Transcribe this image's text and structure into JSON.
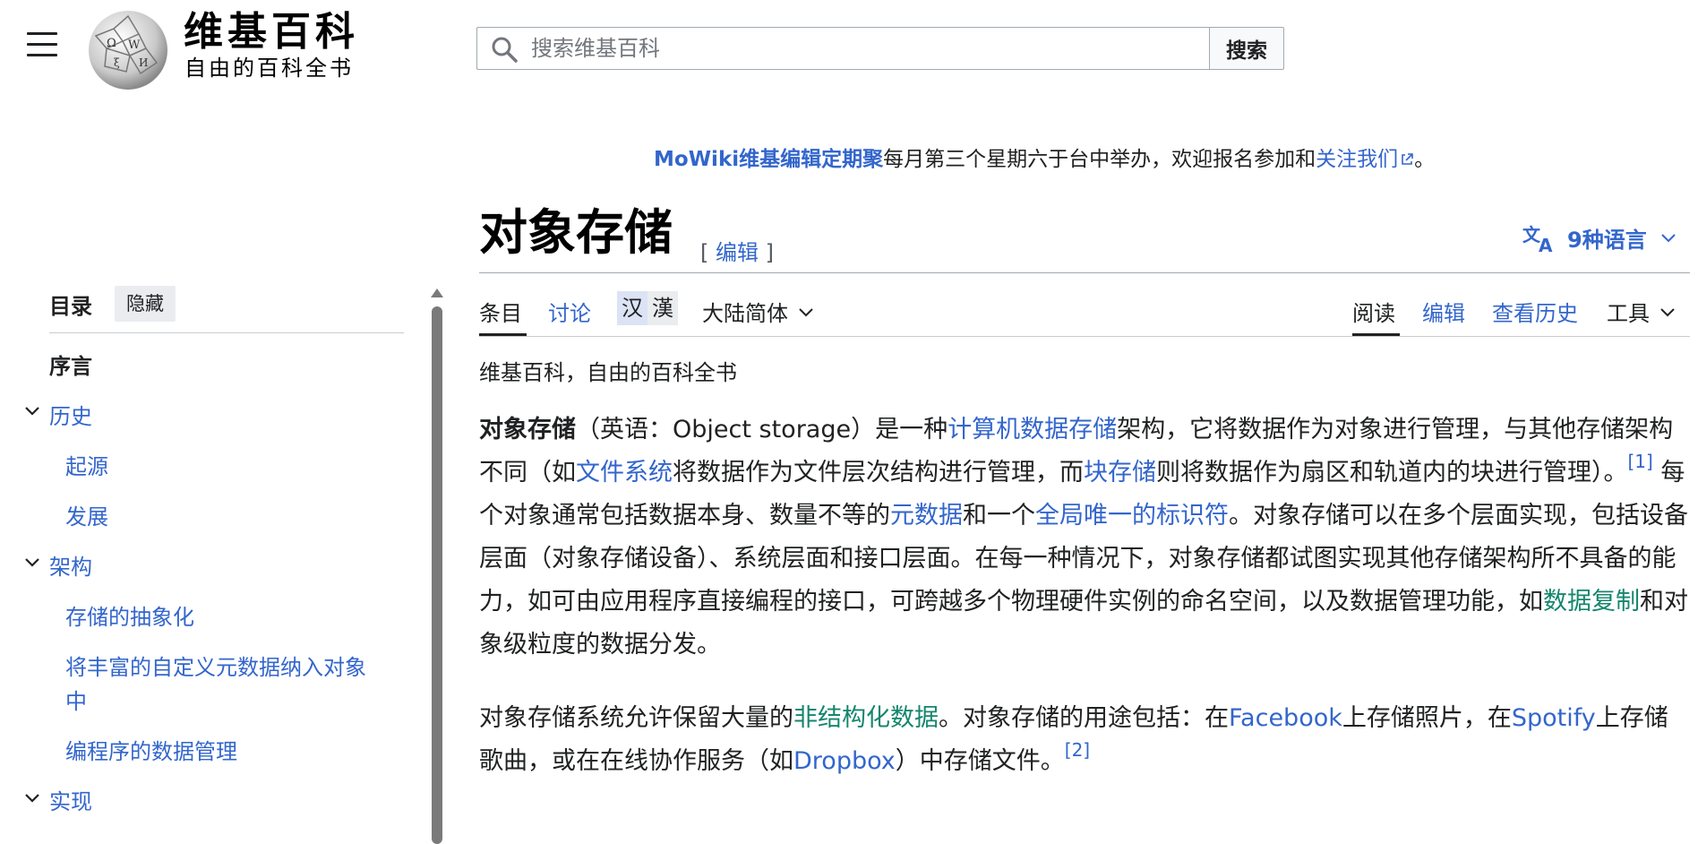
{
  "site": {
    "wordmark": "维基百科",
    "tagline": "自由的百科全书"
  },
  "search": {
    "placeholder": "搜索维基百科",
    "button_label": "搜索"
  },
  "notice": {
    "link_text": "MoWiki维基编辑定期聚",
    "middle_text": "每月第三个星期六于台中举办，欢迎报名参加和",
    "follow_link": "关注我们",
    "end_text": "。"
  },
  "toc": {
    "heading": "目录",
    "hide_label": "隐藏",
    "items": [
      {
        "label": "序言"
      },
      {
        "label": "历史"
      },
      {
        "label": "起源"
      },
      {
        "label": "发展"
      },
      {
        "label": "架构"
      },
      {
        "label": "存储的抽象化"
      },
      {
        "label": "将丰富的自定义元数据纳入对象"
      },
      {
        "label": "中"
      },
      {
        "label": "编程序的数据管理"
      },
      {
        "label": "实现"
      }
    ]
  },
  "page": {
    "title": "对象存储",
    "edit_open": "[ ",
    "edit_label": "编辑",
    "edit_close": " ]",
    "languages": "9种语言"
  },
  "tabs": {
    "article": "条目",
    "talk": "讨论",
    "variant_simplified": "汉",
    "variant_traditional": "漢",
    "variant_dropdown": "大陆简体",
    "read": "阅读",
    "edit": "编辑",
    "history": "查看历史",
    "tools": "工具"
  },
  "content": {
    "site_sub": "维基百科，自由的百科全书",
    "p1": {
      "term": "对象存储",
      "t1": "（英语：Object storage）是一种",
      "l1": "计算机数据存储",
      "t2": "架构，它将数据作为对象进行管理，与其他存储架构不同（如",
      "l2": "文件系统",
      "t3": "将数据作为文件层次结构进行管理，而",
      "l3": "块存储",
      "t4": "则将数据作为扇区和轨道内的块进行管理）。",
      "ref1": "[1]",
      "t5": " 每个对象通常包括数据本身、数量不等的",
      "l4": "元数据",
      "t6": "和一个",
      "l5": "全局唯一的标识符",
      "t7": "。对象存储可以在多个层面实现，包括设备层面（对象存储设备）、系统层面和接口层面。在每一种情况下，对象存储都试图实现其他存储架构所不具备的能力，如可由应用程序直接编程的接口，可跨越多个物理硬件实例的命名空间，以及数据管理功能，如",
      "l6": "数据复制",
      "t8": "和对象级粒度的数据分发。"
    },
    "p2": {
      "t1": "对象存储系统允许保留大量的",
      "l1": "非结构化数据",
      "t2": "。对象存储的用途包括：在",
      "l2": "Facebook",
      "t3": "上存储照片，在",
      "l3": "Spotify",
      "t4": "上存储歌曲，或在在线协作服务（如",
      "l4": "Dropbox",
      "t5": "）中存储文件。",
      "ref2": "[2]"
    }
  }
}
